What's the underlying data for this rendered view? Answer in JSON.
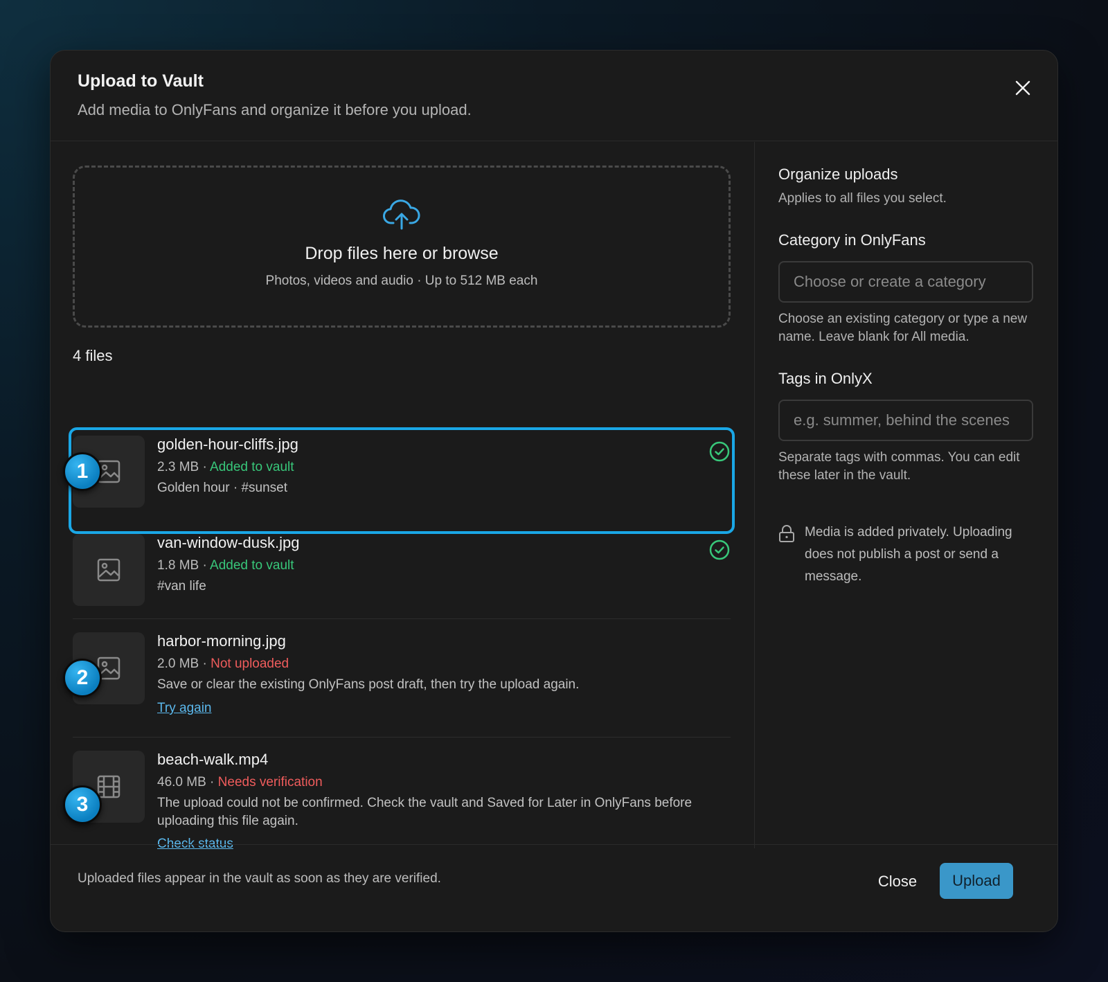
{
  "modal": {
    "title": "Upload to Vault",
    "subtitle": "Add media to OnlyFans and organize it before you upload.",
    "close_icon": "close-icon"
  },
  "dropzone": {
    "icon": "cloud-upload-icon",
    "title": "Drop files here or browse",
    "subtitle": "Photos, videos and audio · Up to 512 MB each"
  },
  "files_count": "4 files",
  "files": [
    {
      "name": "golden-hour-cliffs.jpg",
      "size": "2.3 MB",
      "sep": " · ",
      "status": "Added to vault",
      "status_type": "ok",
      "note": "Golden hour · #sunset",
      "icon": "image-icon",
      "marker": "1"
    },
    {
      "name": "van-window-dusk.jpg",
      "size": "1.8 MB",
      "sep": " · ",
      "status": "Added to vault",
      "status_type": "ok",
      "note": "#van life",
      "icon": "image-icon"
    },
    {
      "name": "harbor-morning.jpg",
      "size": "2.0 MB",
      "sep": " · ",
      "status": "Not uploaded",
      "status_type": "error",
      "note": "Save or clear the existing OnlyFans post draft, then try the upload again.",
      "link": "Try again",
      "icon": "image-icon",
      "marker": "2"
    },
    {
      "name": "beach-walk.mp4",
      "size": "46.0 MB",
      "sep": " · ",
      "status": "Needs verification",
      "status_type": "error",
      "note": "The upload could not be confirmed. Check the vault and Saved for Later in OnlyFans before uploading this file again.",
      "link": "Check status",
      "icon": "film-icon",
      "marker": "3"
    }
  ],
  "organize": {
    "title": "Organize uploads",
    "subtitle": "Applies to all files you select.",
    "category_label": "Category in OnlyFans",
    "category_placeholder": "Choose or create a category",
    "category_help": "Choose an existing category or type a new name. Leave blank for All media.",
    "tags_label": "Tags in OnlyX",
    "tags_placeholder": "e.g. summer, behind the scenes",
    "tags_help": "Separate tags with commas. You can edit these later in the vault.",
    "privacy_note": "Media is added privately. Uploading does not publish a post or send a message."
  },
  "footer": {
    "note": "Uploaded files appear in the vault as soon as they are verified.",
    "close_label": "Close",
    "upload_label": "Upload"
  },
  "colors": {
    "accent": "#1aa7e6",
    "success": "#38c77a",
    "error": "#ef5c5c",
    "link": "#5bb8ec",
    "upload_button": "#3a97c9"
  }
}
